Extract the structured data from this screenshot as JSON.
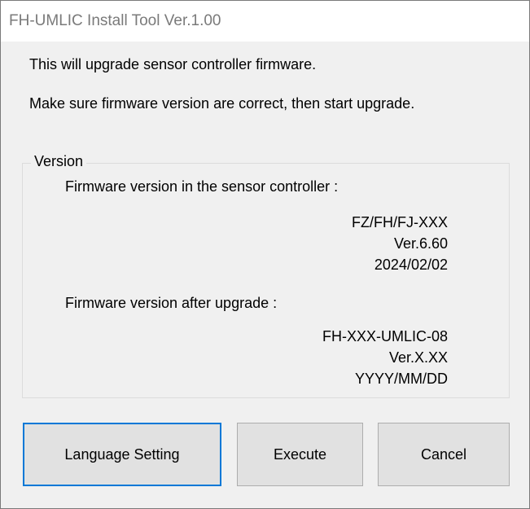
{
  "window": {
    "title": "FH-UMLIC Install Tool Ver.1.00"
  },
  "intro": {
    "line1": "This will upgrade sensor controller firmware.",
    "line2": "Make sure firmware version are correct, then start upgrade."
  },
  "version_group": {
    "label": "Version",
    "current": {
      "label": "Firmware version in the sensor controller :",
      "model": "FZ/FH/FJ-XXX",
      "version": "Ver.6.60",
      "date": "2024/02/02"
    },
    "after": {
      "label": "Firmware version after upgrade :",
      "model": "FH-XXX-UMLIC-08",
      "version": "Ver.X.XX",
      "date": "YYYY/MM/DD"
    }
  },
  "buttons": {
    "language": "Language Setting",
    "execute": "Execute",
    "cancel": "Cancel"
  },
  "colors": {
    "window_bg": "#f0f0f0",
    "title_text": "#7a7a7a",
    "button_bg": "#e1e1e1",
    "focus_border": "#0078d7"
  }
}
